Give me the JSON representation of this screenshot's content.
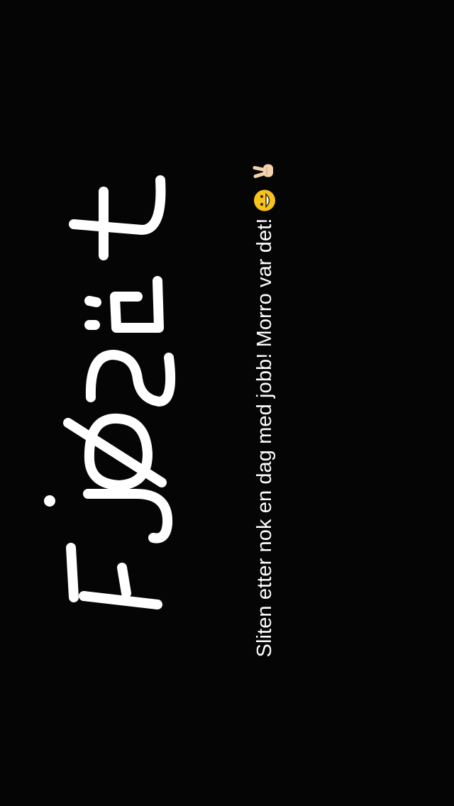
{
  "snap": {
    "caption_text": "Sliten etter nok en dag med jobb! Morro var det!",
    "drawing_text": "Fjøset",
    "caption_emojis": [
      "grinning-face-emoji",
      "victory-hand-emoji"
    ],
    "colors": {
      "background": "#050505",
      "ink": "#ffffff",
      "emoji_face": "#f6c21c",
      "emoji_skin": "#f3d2b0"
    }
  }
}
